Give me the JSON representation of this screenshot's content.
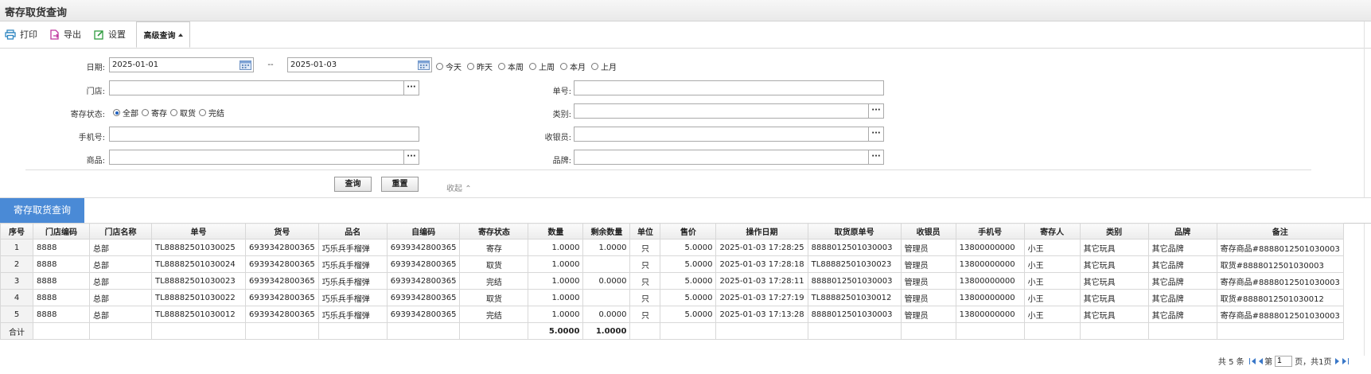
{
  "window": {
    "title": "寄存取货查询"
  },
  "toolbar": {
    "print": "打印",
    "export": "导出",
    "settings": "设置",
    "advanced": "高级查询"
  },
  "form": {
    "date_label": "日期:",
    "date_from": "2025-01-01",
    "date_sep": "--",
    "date_to": "2025-01-03",
    "quick_dates": [
      "今天",
      "昨天",
      "本周",
      "上周",
      "本月",
      "上月"
    ],
    "store_label": "门店:",
    "order_label": "单号:",
    "status_label": "寄存状态:",
    "status_options": [
      "全部",
      "寄存",
      "取货",
      "完结"
    ],
    "status_selected": "全部",
    "category_label": "类别:",
    "phone_label": "手机号:",
    "cashier_label": "收银员:",
    "product_label": "商品:",
    "brand_label": "品牌:",
    "store_value": "",
    "order_value": "",
    "category_value": "",
    "phone_value": "",
    "cashier_value": "",
    "product_value": "",
    "brand_value": "",
    "query_btn": "查询",
    "reset_btn": "重置",
    "collapse": "收起"
  },
  "grid": {
    "title": "寄存取货查询",
    "columns": [
      "序号",
      "门店编码",
      "门店名称",
      "单号",
      "货号",
      "品名",
      "自编码",
      "寄存状态",
      "数量",
      "剩余数量",
      "单位",
      "售价",
      "操作日期",
      "取货原单号",
      "收银员",
      "手机号",
      "寄存人",
      "类别",
      "品牌",
      "备注"
    ],
    "rows": [
      [
        "1",
        "8888",
        "总部",
        "TL88882501030025",
        "6939342800365",
        "巧乐兵手榴弹",
        "6939342800365",
        "寄存",
        "1.0000",
        "1.0000",
        "只",
        "5.0000",
        "2025-01-03 17:28:25",
        "8888012501030003",
        "管理员",
        "13800000000",
        "小王",
        "其它玩具",
        "其它品牌",
        "寄存商品#8888012501030003"
      ],
      [
        "2",
        "8888",
        "总部",
        "TL88882501030024",
        "6939342800365",
        "巧乐兵手榴弹",
        "6939342800365",
        "取货",
        "1.0000",
        "",
        "只",
        "5.0000",
        "2025-01-03 17:28:18",
        "TL88882501030023",
        "管理员",
        "13800000000",
        "小王",
        "其它玩具",
        "其它品牌",
        "取货#8888012501030003"
      ],
      [
        "3",
        "8888",
        "总部",
        "TL88882501030023",
        "6939342800365",
        "巧乐兵手榴弹",
        "6939342800365",
        "完结",
        "1.0000",
        "0.0000",
        "只",
        "5.0000",
        "2025-01-03 17:28:11",
        "8888012501030003",
        "管理员",
        "13800000000",
        "小王",
        "其它玩具",
        "其它品牌",
        "寄存商品#8888012501030003"
      ],
      [
        "4",
        "8888",
        "总部",
        "TL88882501030022",
        "6939342800365",
        "巧乐兵手榴弹",
        "6939342800365",
        "取货",
        "1.0000",
        "",
        "只",
        "5.0000",
        "2025-01-03 17:27:19",
        "TL88882501030012",
        "管理员",
        "13800000000",
        "小王",
        "其它玩具",
        "其它品牌",
        "取货#8888012501030012"
      ],
      [
        "5",
        "8888",
        "总部",
        "TL88882501030012",
        "6939342800365",
        "巧乐兵手榴弹",
        "6939342800365",
        "完结",
        "1.0000",
        "0.0000",
        "只",
        "5.0000",
        "2025-01-03 17:13:28",
        "8888012501030003",
        "管理员",
        "13800000000",
        "小王",
        "其它玩具",
        "其它品牌",
        "寄存商品#8888012501030003"
      ]
    ],
    "total_label": "合计",
    "total_qty": "5.0000",
    "total_remain": "1.0000"
  },
  "pager": {
    "total": "共 5 条",
    "page_prefix": "第",
    "page": "1",
    "page_suffix": "页，共1页"
  }
}
